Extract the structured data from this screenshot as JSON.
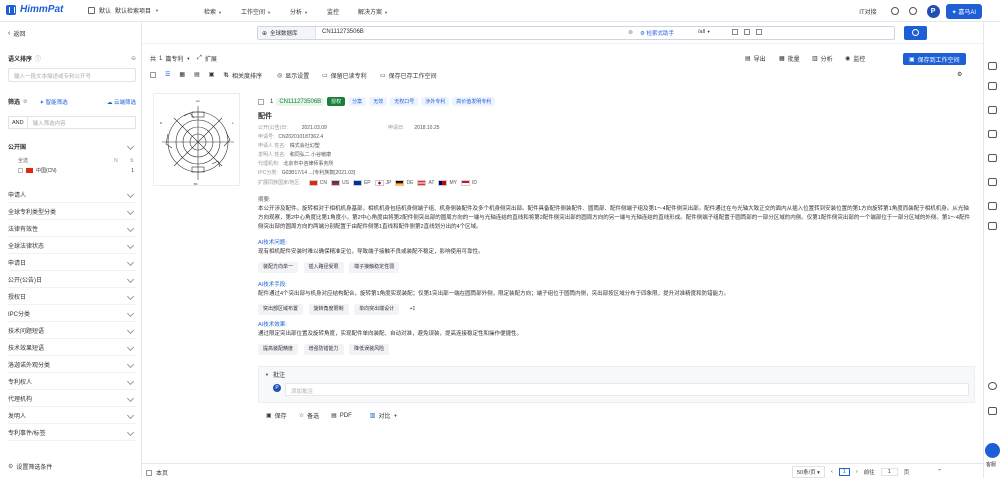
{
  "topbar": {
    "logo_text": "HimmPat",
    "workspace_default": "默认",
    "workspace_name": "默认检索项目",
    "nav": [
      "检索",
      "工作空间",
      "分析",
      "监控",
      "解决方案"
    ],
    "right_text": "IT对接",
    "ai_button": "嘉马AI",
    "avatar_letter": "P"
  },
  "left": {
    "back": "返回",
    "semantic_sort": "语义排序",
    "semantic_placeholder": "输入一段文本描述或专利公开号",
    "filter_title": "筛选",
    "smart_filter": "智能筛选",
    "cloud_filter": "云端筛选",
    "and_label": "AND",
    "filter_placeholder": "输入筛选内容",
    "tree": [
      {
        "name": "公开国"
      },
      {
        "name": "申请人"
      },
      {
        "name": "全球专利类型分类"
      },
      {
        "name": "法律有效性"
      },
      {
        "name": "全球法律状态"
      },
      {
        "name": "申请日"
      },
      {
        "name": "公开(公告)日"
      },
      {
        "name": "授权日"
      },
      {
        "name": "IPC分类"
      },
      {
        "name": "技术问题短语"
      },
      {
        "name": "技术效果短语"
      },
      {
        "name": "洛迦诺外观分类"
      },
      {
        "name": "专利权人"
      },
      {
        "name": "代理机构"
      },
      {
        "name": "发明人"
      },
      {
        "name": "专利事件/标签"
      }
    ],
    "sub_all": "全选",
    "sub_n": "N",
    "sub_cn": "中国(CN)",
    "sub_cn_count": "1",
    "bottom": "设置筛选条件"
  },
  "search": {
    "database": "全球数据库",
    "query": "CN111273506B",
    "mode_btn": "检索式助手",
    "lang": "/all"
  },
  "toolbar": {
    "total_prefix": "共",
    "total": "1",
    "total_suffix": "篇专利",
    "expand": "扩展",
    "actions_right": [
      "导出",
      "批量",
      "分析",
      "监控"
    ],
    "save_ws": "保存到工作空间",
    "sort_relevance": "相关度排序",
    "display_settings": "显示设置",
    "saved_read": "保留已读专利",
    "saved_ws": "保存已存工作空间"
  },
  "card": {
    "index": "1",
    "pubno": "CN111273506B",
    "status": "授权",
    "tags": [
      "分案",
      "无效",
      "无权口号",
      "涉外专利",
      "高价值发明专利"
    ],
    "title": "配件",
    "pub_date_label": "公开(公告)日:",
    "pub_date": "2021.03.09",
    "app_date_label": "申请日:",
    "app_date": "2018.10.25",
    "appno_label": "申请号:",
    "appno": "CN202010187362.4",
    "applicant_label": "申请人 姓名:",
    "applicant": "株式会社幻塑",
    "inventor_label": "发明人 姓名:",
    "inventor": "和同弘二  小谷敏康",
    "agent_label": "代理机构:",
    "agent": "北京市中咨律师事务所",
    "ipc_label": "IPC分类:",
    "ipc": "G03B17/14    ...(专利族数[2021.03]",
    "family_label": "扩展同族国家/地区:",
    "flags": [
      {
        "code": "CN",
        "color": "#de2910"
      },
      {
        "code": "US",
        "color": "#3c3b6e"
      },
      {
        "code": "EP",
        "color": "#003399"
      },
      {
        "code": "JP",
        "color": "#ffffff"
      },
      {
        "code": "DE",
        "color": "#000000"
      },
      {
        "code": "AT",
        "color": "#ed2939"
      },
      {
        "code": "MY",
        "color": "#010066"
      },
      {
        "code": "ID",
        "color": "#ce1126"
      }
    ],
    "abstract_label": "摘要:",
    "abstract": "本公开涉及配件。旋转相对于相机机身基部，相机机身包括机身侧端子组、机身侧装配件及多个机身侧突出部。配件具备配件侧装配件、圆筒部、配件侧端子组及第1～4配件侧突出部。配件通过在与光轴大致正交的面内从插入位置转到安装位置的第1方向旋转第1角度而装配于相机机身。从光轴方向观察，第2中心角度比第1角度小，第2中心角度由将第2配件侧突出部的圆周方向的一端与光轴连结的直线和将第2配件侧突出部的圆周方向的另一端与光轴连结的直线形成。配件侧端子组配置于圆筒部的一部分区域的内侧。仅第1配件侧突出部的一个端部位于一部分区域的外侧。第1～4配件侧突出部的圆周方向的两端分别配置于由配件侧第1直线和配件侧第2直线划分出的4个区域。",
    "ai_problem_label": "AI技术问题:",
    "ai_problem": "现有相机配件安装时难以确保精准定位，导致端子接触不良或装配不稳定，影响使用可靠性。",
    "problem_chips": [
      "装配方向单一",
      "插入路径受限",
      "端子接触稳定性弱"
    ],
    "ai_means_label": "AI技术手段:",
    "ai_means": "配件通过4个突出部与机身对应结构配合，旋转第1角度实现装配；仅第1突出部一端在圆筒部外侧，限定装配方向；端子组位于圆筒内侧，突出部按区域分布于四象限，提升对准精度和防错能力。",
    "means_chips": [
      "突出部区域布置",
      "旋转角度限制",
      "单向突出端设计",
      "+1"
    ],
    "ai_effect_label": "AI技术效果:",
    "ai_effect": "通过限定突出部位置及旋转角度，实现配件单向装配、自动对准，避免误装，提高连接稳定性和操作便捷性。",
    "effect_chips": [
      "提高装配精度",
      "增强防错能力",
      "降低误装风险"
    ],
    "note_label": "批注",
    "note_placeholder": "添加批注",
    "actions": [
      "保存",
      "备选",
      "PDF",
      "对比"
    ]
  },
  "footer": {
    "this_page": "本页",
    "page_size": "50条/页",
    "page": "1",
    "goto_label": "前往",
    "goto_value": "1",
    "page_unit": "页"
  },
  "rail": {
    "help": "客服"
  }
}
